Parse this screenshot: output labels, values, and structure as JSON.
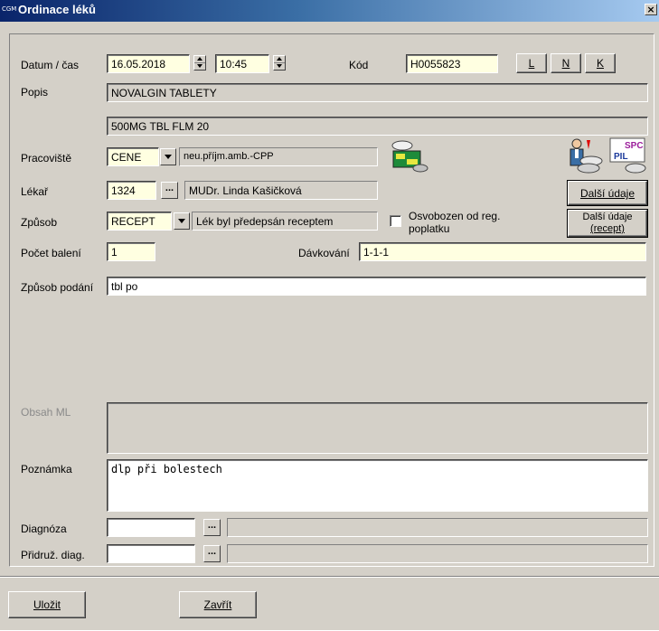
{
  "window": {
    "title": "Ordinace léků",
    "logo": "CGM",
    "close_label": "×"
  },
  "labels": {
    "datum_cas": "Datum / čas",
    "kod": "Kód",
    "popis": "Popis",
    "pracoviste": "Pracoviště",
    "lekar": "Lékař",
    "zpusob": "Způsob",
    "pocet_baleni": "Počet balení",
    "davkovani": "Dávkování",
    "zpusob_podani": "Způsob podání",
    "obsah_ml": "Obsah ML",
    "poznamka": "Poznámka",
    "diagnoza": "Diagnóza",
    "pridruz_diag": "Přidruž. diag."
  },
  "fields": {
    "datum": "16.05.2018",
    "cas": "10:45",
    "kod": "H0055823",
    "popis1": "NOVALGIN TABLETY",
    "popis2": "500MG TBL FLM 20",
    "pracoviste_code": "CENE",
    "pracoviste_name": "neu.příjm.amb.-CPP",
    "lekar_code": "1324",
    "lekar_name": "MUDr. Linda Kašičková",
    "zpusob_code": "RECEPT",
    "zpusob_name": "Lék byl předepsán receptem",
    "pocet_baleni": "1",
    "davkovani": "1-1-1",
    "zpusob_podani": "tbl po",
    "obsah_ml": "",
    "poznamka": "dlp při bolestech",
    "diagnoza_code": "",
    "diagnoza_name": "",
    "pridruz_code": "",
    "pridruz_name": ""
  },
  "buttons": {
    "l": "L",
    "n": "N",
    "k": "K",
    "ellipsis": "...",
    "dalsi_udaje": "Další údaje",
    "dalsi_udaje_recept_1": "Další údaje",
    "dalsi_udaje_recept_2": "(recept)",
    "ulozit": "Uložit",
    "zavrit": "Zavřít"
  },
  "checkbox": {
    "label_1": "Osvobozen od reg.",
    "label_2": "poplatku",
    "checked": false
  },
  "icons": {
    "spc": "SPC",
    "pil": "PIL"
  }
}
